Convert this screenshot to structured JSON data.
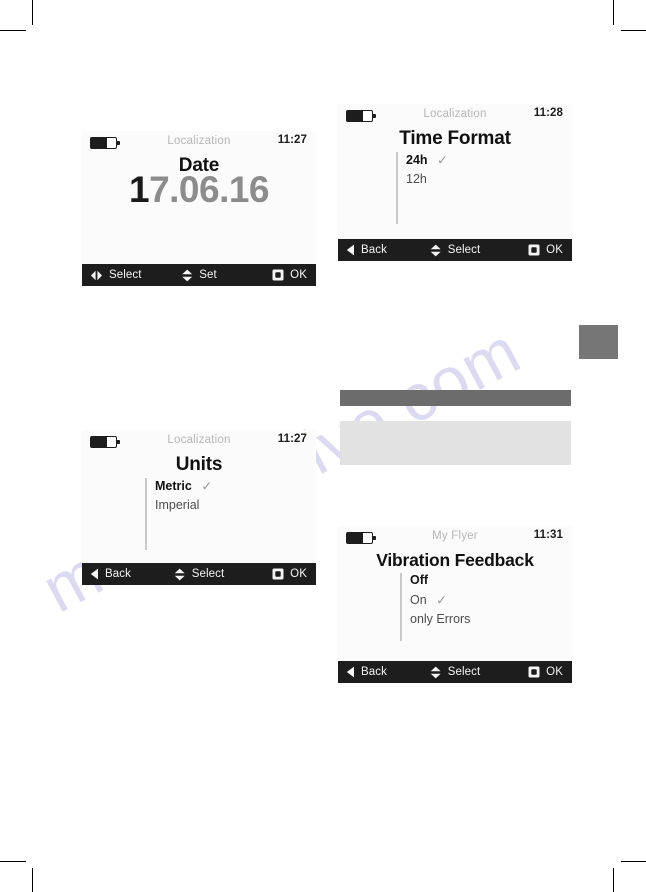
{
  "page": {
    "watermark_text": "manualshive.com",
    "watermark_color": "#c7c5e8"
  },
  "decorations": {
    "tab_marker_color": "#767676",
    "dark_bar_color": "#6c6c6c",
    "light_panel_color": "#e2e2e2"
  },
  "screens": [
    {
      "id": "date",
      "breadcrumb": "Localization",
      "time": "11:27",
      "title": "Date",
      "battery_icon": "battery-icon",
      "value": {
        "active_part": "1",
        "rest_part": "7.06.16",
        "full": "17.06.16"
      },
      "footer": {
        "left": {
          "icon": "left-right-arrows-icon",
          "label": "Select"
        },
        "center": {
          "icon": "up-down-arrows-icon",
          "label": "Set"
        },
        "right": {
          "icon": "ok-square-icon",
          "label": "OK"
        }
      }
    },
    {
      "id": "time-format",
      "breadcrumb": "Localization",
      "time": "11:28",
      "title": "Time Format",
      "battery_icon": "battery-icon",
      "options": [
        {
          "label": "24h",
          "selected": true,
          "checked": true
        },
        {
          "label": "12h",
          "selected": false,
          "checked": false
        }
      ],
      "footer": {
        "left": {
          "icon": "back-arrow-icon",
          "label": "Back"
        },
        "center": {
          "icon": "up-down-arrows-icon",
          "label": "Select"
        },
        "right": {
          "icon": "ok-square-icon",
          "label": "OK"
        }
      }
    },
    {
      "id": "units",
      "breadcrumb": "Localization",
      "time": "11:27",
      "title": "Units",
      "battery_icon": "battery-icon",
      "options": [
        {
          "label": "Metric",
          "selected": true,
          "checked": true
        },
        {
          "label": "Imperial",
          "selected": false,
          "checked": false
        }
      ],
      "footer": {
        "left": {
          "icon": "back-arrow-icon",
          "label": "Back"
        },
        "center": {
          "icon": "up-down-arrows-icon",
          "label": "Select"
        },
        "right": {
          "icon": "ok-square-icon",
          "label": "OK"
        }
      }
    },
    {
      "id": "vibration",
      "breadcrumb": "My Flyer",
      "time": "11:31",
      "title": "Vibration Feedback",
      "battery_icon": "battery-icon",
      "options": [
        {
          "label": "Off",
          "selected": true,
          "checked": false
        },
        {
          "label": "On",
          "selected": false,
          "checked": true
        },
        {
          "label": "only Errors",
          "selected": false,
          "checked": false
        }
      ],
      "footer": {
        "left": {
          "icon": "back-arrow-icon",
          "label": "Back"
        },
        "center": {
          "icon": "up-down-arrows-icon",
          "label": "Select"
        },
        "right": {
          "icon": "ok-square-icon",
          "label": "OK"
        }
      }
    }
  ],
  "check_glyph": "✓"
}
